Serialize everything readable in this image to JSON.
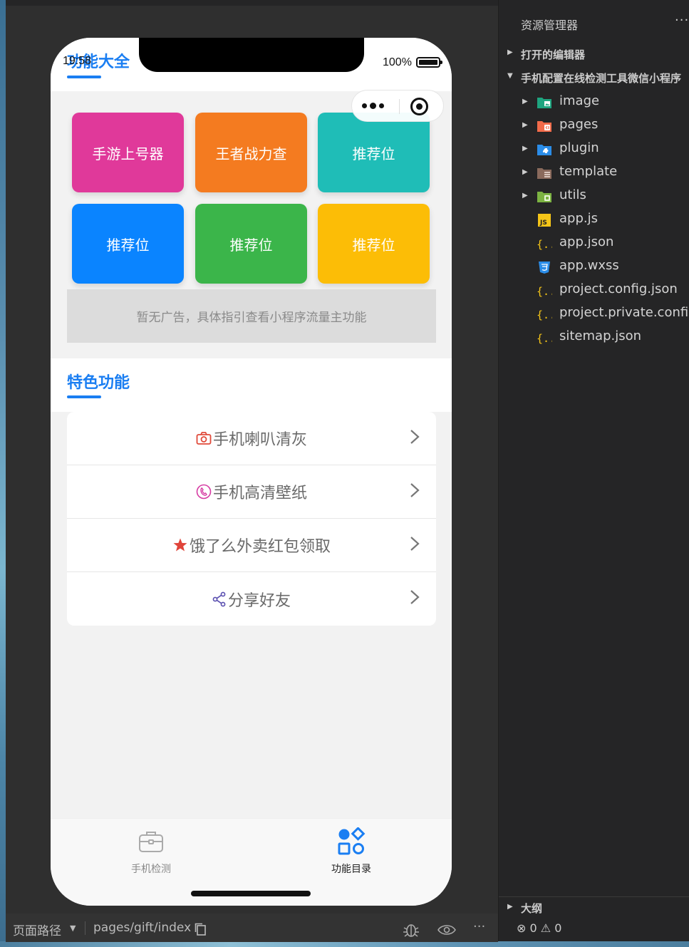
{
  "phone": {
    "status": {
      "time": "19:58",
      "battery": "100%"
    },
    "section1_title": "功能大全",
    "tiles": [
      {
        "label": "手游上号器",
        "color": "#e0399a"
      },
      {
        "label": "王者战力查",
        "color": "#f47b20"
      },
      {
        "label": "推荐位",
        "color": "#1fbdb7"
      },
      {
        "label": "推荐位",
        "color": "#0a84ff"
      },
      {
        "label": "推荐位",
        "color": "#3bb54a"
      },
      {
        "label": "推荐位",
        "color": "#fcbd06"
      }
    ],
    "ad_text": "暂无广告，具体指引查看小程序流量主功能",
    "section2_title": "特色功能",
    "features": [
      {
        "icon": "camera-icon",
        "label": "手机喇叭清灰"
      },
      {
        "icon": "phone-icon",
        "label": "手机高清壁纸"
      },
      {
        "icon": "star-icon",
        "label": "饿了么外卖红包领取"
      },
      {
        "icon": "share-icon",
        "label": "分享好友"
      }
    ],
    "tabbar": [
      {
        "label": "手机检测",
        "icon": "toolbox-icon",
        "active": false
      },
      {
        "label": "功能目录",
        "icon": "apps-icon",
        "active": true
      }
    ]
  },
  "bottombar": {
    "path_label": "页面路径",
    "path": "pages/gift/index"
  },
  "explorer": {
    "title": "资源管理器",
    "more": "···",
    "open_editors": "打开的编辑器",
    "project": "手机配置在线检测工具微信小程序",
    "items": [
      {
        "label": "image",
        "type": "folder",
        "icon": "image-folder-icon"
      },
      {
        "label": "pages",
        "type": "folder",
        "icon": "pages-folder-icon"
      },
      {
        "label": "plugin",
        "type": "folder",
        "icon": "plugin-folder-icon"
      },
      {
        "label": "template",
        "type": "folder",
        "icon": "template-folder-icon"
      },
      {
        "label": "utils",
        "type": "folder",
        "icon": "utils-folder-icon"
      },
      {
        "label": "app.js",
        "type": "file",
        "icon": "js-file-icon"
      },
      {
        "label": "app.json",
        "type": "file",
        "icon": "json-file-icon"
      },
      {
        "label": "app.wxss",
        "type": "file",
        "icon": "css-file-icon"
      },
      {
        "label": "project.config.json",
        "type": "file",
        "icon": "json-file-icon"
      },
      {
        "label": "project.private.config.json",
        "type": "file",
        "icon": "json-file-icon"
      },
      {
        "label": "sitemap.json",
        "type": "file",
        "icon": "json-file-icon"
      }
    ],
    "outline": "大纲",
    "errors": "0",
    "warnings": "0"
  }
}
